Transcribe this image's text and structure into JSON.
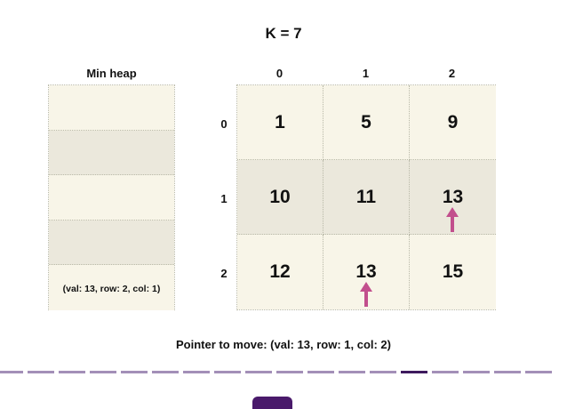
{
  "title": "K = 7",
  "heap": {
    "title": "Min heap",
    "slots": [
      "",
      "",
      "",
      "",
      "(val: 13, row: 2, col: 1)"
    ]
  },
  "matrix": {
    "col_labels": [
      "0",
      "1",
      "2"
    ],
    "row_labels": [
      "0",
      "1",
      "2"
    ],
    "rows": [
      [
        "1",
        "5",
        "9"
      ],
      [
        "10",
        "11",
        "13"
      ],
      [
        "12",
        "13",
        "15"
      ]
    ]
  },
  "pointers": [
    {
      "row": 1,
      "col": 2,
      "icon": "up-arrow-icon"
    },
    {
      "row": 2,
      "col": 1,
      "icon": "up-arrow-icon"
    }
  ],
  "status": {
    "pointer_to_move": "Pointer to move: (val: 13, row: 1, col: 2)"
  },
  "progress": {
    "total_steps": 18,
    "current_step": 14
  },
  "colors": {
    "cell_light": "#f8f5e8",
    "cell_dark": "#ebe8dc",
    "pointer": "#c24f8d",
    "progress_inactive": "#a38fb8",
    "progress_active": "#3e1a5e",
    "button": "#4a1a6b"
  }
}
